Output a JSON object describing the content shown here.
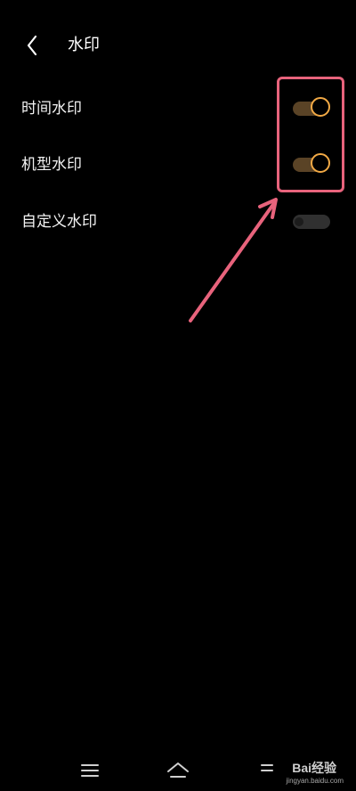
{
  "header": {
    "title": "水印",
    "back_icon": "chevron-left-icon"
  },
  "rows": [
    {
      "label": "时间水印",
      "enabled": true
    },
    {
      "label": "机型水印",
      "enabled": true
    },
    {
      "label": "自定义水印",
      "enabled": false
    }
  ],
  "colors": {
    "background": "#000000",
    "toggle_on_knob": "#f1a945",
    "toggle_on_track": "#5a4326",
    "toggle_off_track": "#303030",
    "annotation": "#e8637c"
  },
  "navbar": {
    "icons": [
      "menu-icon",
      "home-icon",
      "back-icon"
    ]
  },
  "watermark": {
    "brand": "Bai经验",
    "url": "jingyan.baidu.com"
  }
}
